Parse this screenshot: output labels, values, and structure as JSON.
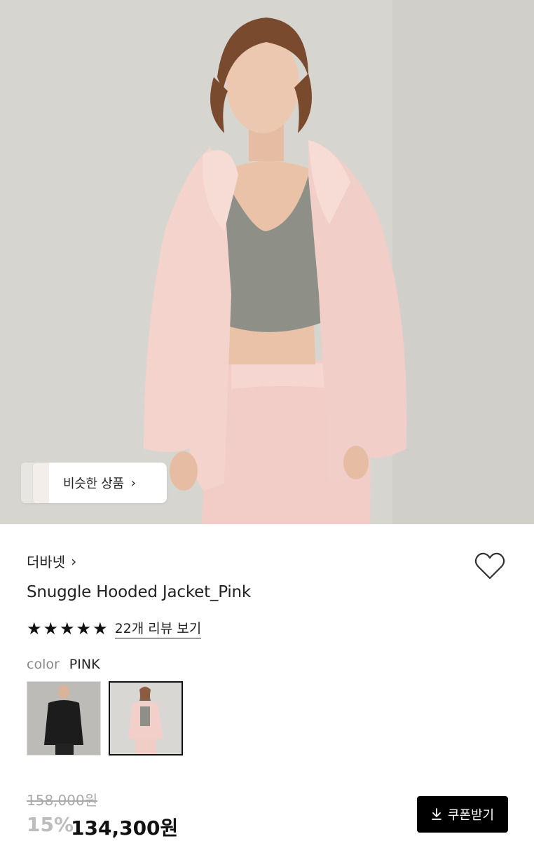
{
  "hero": {
    "image": "model-wearing-pink-hooded-jacket"
  },
  "similar": {
    "label": "비슷한 상품",
    "chevron": "›"
  },
  "product": {
    "brand": "더바넷",
    "brand_chevron": "›",
    "name": "Snuggle Hooded Jacket_Pink",
    "rating_stars": 5,
    "review_link": "22개 리뷰 보기",
    "color_label": "color",
    "color_value": "PINK"
  },
  "swatches": [
    {
      "name": "black",
      "selected": false
    },
    {
      "name": "pink",
      "selected": true
    }
  ],
  "price": {
    "original": "158,000원",
    "discount": "15%",
    "sale": "134,300원"
  },
  "coupon": {
    "label": "쿠폰받기",
    "icon": "download-icon"
  },
  "colors": {
    "accent": "#000000",
    "discount_gray": "#bdbdbd",
    "strike_gray": "#aaaaaa"
  }
}
